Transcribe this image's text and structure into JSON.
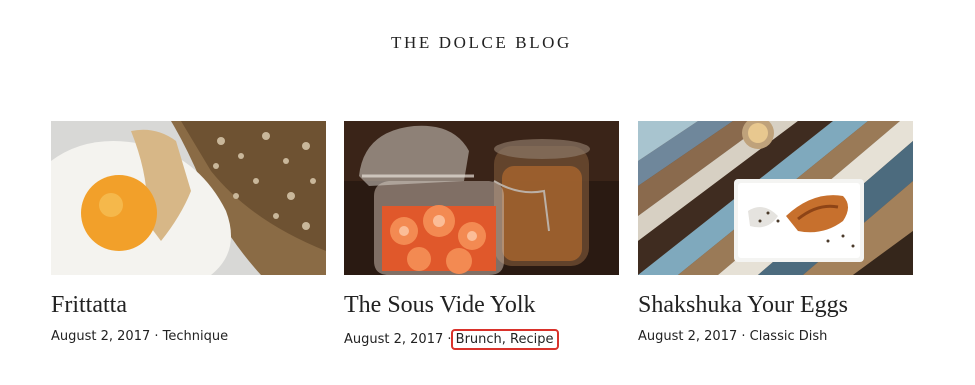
{
  "blog": {
    "title": "THE DOLCE BLOG"
  },
  "posts": [
    {
      "title": "Frittatta",
      "date": "August 2, 2017",
      "separator": " · ",
      "categories": "Technique",
      "image_icon": "fried-egg-photo"
    },
    {
      "title": "The Sous Vide Yolk",
      "date": "August 2, 2017",
      "separator": " · ",
      "categories": "Brunch, Recipe",
      "image_icon": "mason-jars-photo"
    },
    {
      "title": "Shakshuka Your Eggs",
      "date": "August 2, 2017",
      "separator": " · ",
      "categories": "Classic Dish",
      "image_icon": "plated-dish-photo"
    }
  ],
  "colors": {
    "highlight_border": "#d9322b",
    "text": "#222222"
  }
}
